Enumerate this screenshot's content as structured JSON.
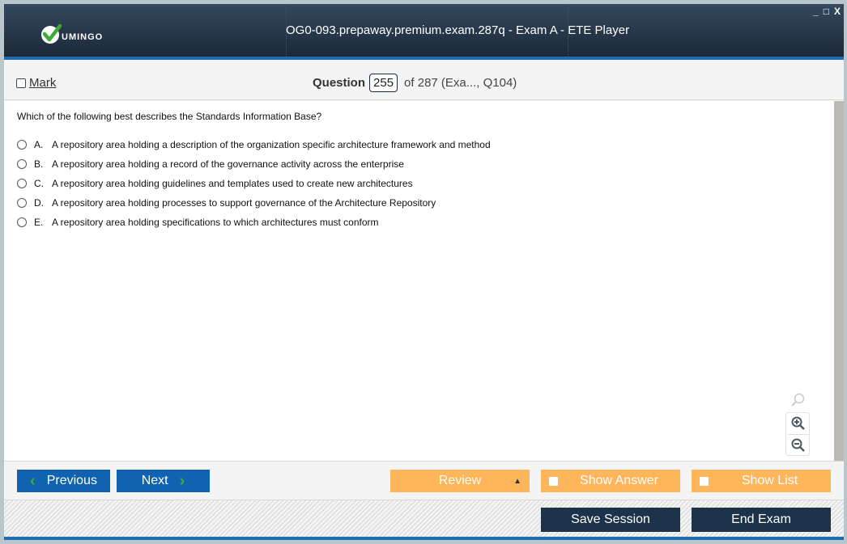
{
  "window": {
    "title": "OG0-093.prepaway.premium.exam.287q - Exam A - ETE Player",
    "logo_text": "UMINGO",
    "controls": [
      "_",
      "□",
      "X"
    ]
  },
  "question_bar": {
    "mark_label": "Mark",
    "mark_checked": false,
    "question_label": "Question",
    "current_question": "255",
    "of_text": "of 287 (Exa..., Q104)"
  },
  "question": {
    "text": "Which of the following best describes the Standards Information Base?",
    "options": [
      {
        "letter": "A.",
        "text": "A repository area holding a description of the organization specific architecture framework and method"
      },
      {
        "letter": "B.",
        "text": "A repository area holding a record of the governance activity across the enterprise"
      },
      {
        "letter": "C.",
        "text": "A repository area holding guidelines and templates used to create new architectures"
      },
      {
        "letter": "D.",
        "text": "A repository area holding processes to support governance of the Architecture Repository"
      },
      {
        "letter": "E.",
        "text": "A repository area holding specifications to which architectures must conform"
      }
    ]
  },
  "zoom_tools": [
    "magnifier-icon",
    "zoom-in-icon",
    "zoom-out-icon"
  ],
  "buttons": {
    "previous": "Previous",
    "next": "Next",
    "review": "Review",
    "show_answer": "Show Answer",
    "show_list": "Show List",
    "save_session": "Save Session",
    "end_exam": "End Exam"
  },
  "colors": {
    "title_bar": "#1c2838",
    "accent_blue": "#1f6cb5",
    "nav_button": "#0f63b0",
    "orange_button": "#ffb55a",
    "dark_button": "#1c3349",
    "logo_check": "#3daa3a"
  }
}
